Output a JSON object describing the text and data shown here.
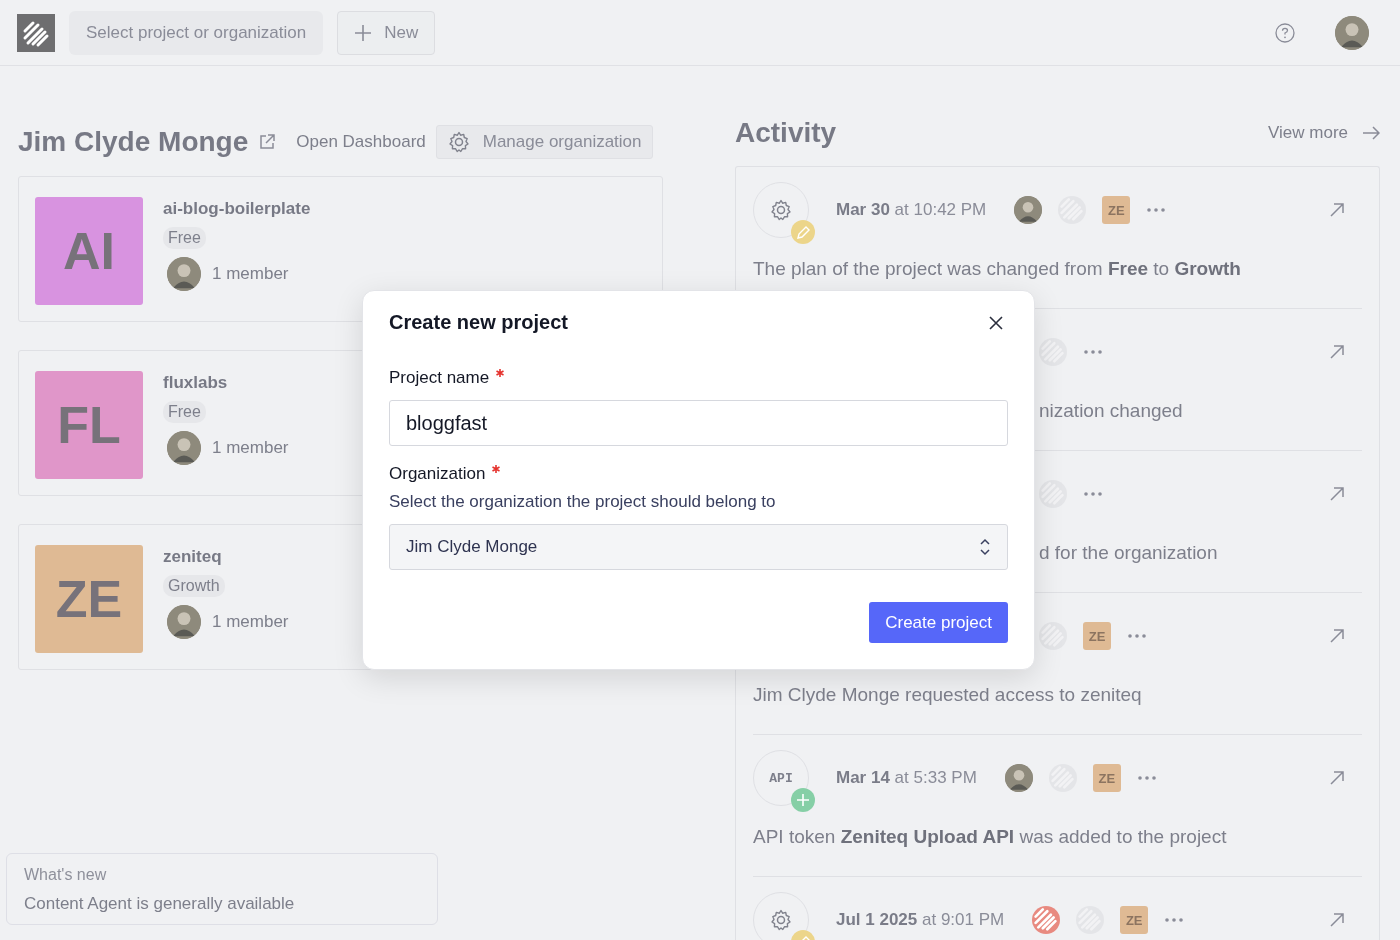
{
  "topbar": {
    "project_selector": "Select project or organization",
    "new_button": "New"
  },
  "organization": {
    "name": "Jim Clyde Monge",
    "open_dashboard": "Open Dashboard",
    "manage": "Manage organization"
  },
  "projects": [
    {
      "initials": "AI",
      "color": "#d893e0",
      "name": "ai-blog-boilerplate",
      "plan": "Free",
      "members": "1 member"
    },
    {
      "initials": "FL",
      "color": "#e096c9",
      "name": "fluxlabs",
      "plan": "Free",
      "members": "1 member"
    },
    {
      "initials": "ZE",
      "color": "#dfba94",
      "name": "zeniteq",
      "plan": "Growth",
      "members": "1 member"
    }
  ],
  "whats_new": {
    "heading": "What's new",
    "text": "Content Agent is generally available"
  },
  "activity": {
    "title": "Activity",
    "view_more": "View more",
    "items": [
      {
        "kind": "full",
        "icon": {
          "kind": "gear"
        },
        "badge": {
          "kind": "edit"
        },
        "date": "**Mar 30** at 10:42 PM",
        "participants": [
          {
            "kind": "photo"
          },
          {
            "kind": "logo"
          },
          {
            "kind": "org",
            "label": "ZE"
          }
        ],
        "text": "The plan of the project was changed from **Free** to **Growth**"
      },
      {
        "kind": "covered",
        "participants": [
          {
            "kind": "logo"
          }
        ],
        "text": "nization changed"
      },
      {
        "kind": "covered",
        "participants": [
          {
            "kind": "logo"
          }
        ],
        "text": "d for the organization"
      },
      {
        "kind": "header_covered",
        "participants": [
          {
            "kind": "logo"
          },
          {
            "kind": "org",
            "label": "ZE"
          }
        ],
        "text": "Jim Clyde Monge requested access to zeniteq"
      },
      {
        "kind": "full",
        "icon": {
          "kind": "api",
          "label": "API"
        },
        "badge": {
          "kind": "add"
        },
        "date": "**Mar 14** at 5:33 PM",
        "participants": [
          {
            "kind": "photo"
          },
          {
            "kind": "logo"
          },
          {
            "kind": "org",
            "label": "ZE"
          }
        ],
        "text": "API token **Zeniteq Upload API** was added to the project"
      },
      {
        "kind": "full",
        "icon": {
          "kind": "gear"
        },
        "badge": {
          "kind": "edit"
        },
        "date": "**Jul 1 2025** at 9:01 PM",
        "participants": [
          {
            "kind": "brand"
          },
          {
            "kind": "logo"
          },
          {
            "kind": "org",
            "label": "ZE"
          }
        ]
      }
    ]
  },
  "modal": {
    "title": "Create new project",
    "fields": [
      {
        "kind": "text",
        "label": "Project name",
        "required": true,
        "value": "bloggfast"
      },
      {
        "kind": "select",
        "label": "Organization",
        "required": true,
        "help": "Select the organization the project should belong to",
        "value": "Jim Clyde Monge"
      }
    ],
    "submit": "Create project"
  }
}
